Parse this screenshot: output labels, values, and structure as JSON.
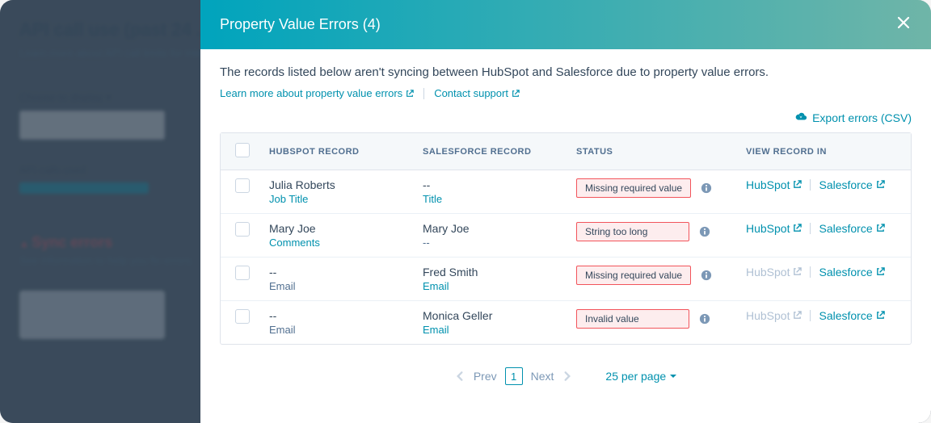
{
  "modal": {
    "title": "Property Value Errors (4)",
    "description": "The records listed below aren't syncing between HubSpot and Salesforce due to property value errors.",
    "learn_more": "Learn more about property value errors",
    "contact_support": "Contact support",
    "export_label": "Export errors (CSV)"
  },
  "table": {
    "headers": {
      "hubspot": "HUBSPOT RECORD",
      "salesforce": "SALESFORCE RECORD",
      "status": "STATUS",
      "view": "VIEW RECORD IN"
    }
  },
  "rows": [
    {
      "hs_name": "Julia Roberts",
      "hs_prop": "Job Title",
      "hs_prop_link": true,
      "sf_name": "--",
      "sf_prop": "Title",
      "sf_prop_link": true,
      "status": "Missing required value",
      "hs_disabled": false
    },
    {
      "hs_name": "Mary Joe",
      "hs_prop": "Comments",
      "hs_prop_link": true,
      "sf_name": "Mary Joe",
      "sf_prop": "--",
      "sf_prop_link": false,
      "status": "String too long",
      "hs_disabled": false
    },
    {
      "hs_name": "--",
      "hs_prop": "Email",
      "hs_prop_link": false,
      "sf_name": "Fred Smith",
      "sf_prop": "Email",
      "sf_prop_link": true,
      "status": "Missing required value",
      "hs_disabled": true
    },
    {
      "hs_name": "--",
      "hs_prop": "Email",
      "hs_prop_link": false,
      "sf_name": "Monica Geller",
      "sf_prop": "Email",
      "sf_prop_link": true,
      "status": "Invalid value",
      "hs_disabled": true
    }
  ],
  "view_labels": {
    "hubspot": "HubSpot",
    "salesforce": "Salesforce"
  },
  "pager": {
    "prev": "Prev",
    "next": "Next",
    "page": "1",
    "per_page": "25 per page"
  }
}
